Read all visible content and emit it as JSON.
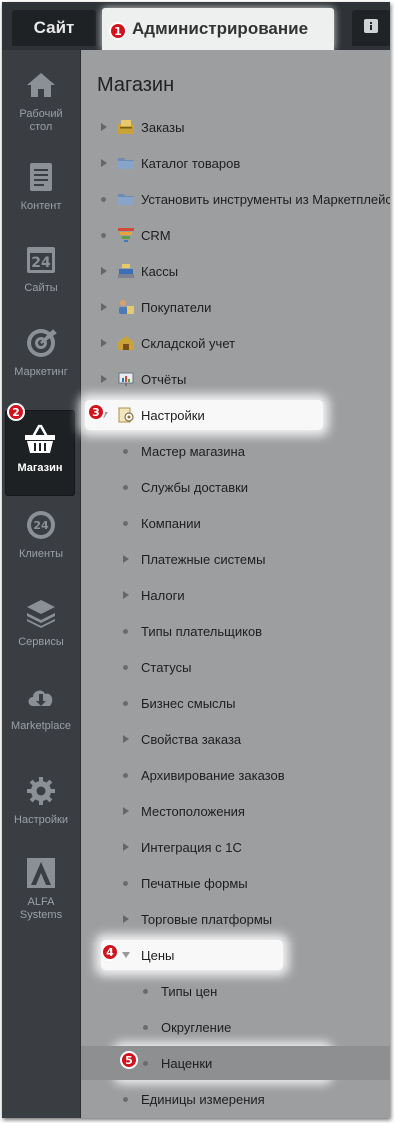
{
  "topbar": {
    "site_tab": "Сайт",
    "admin_tab": "Администрирование",
    "info_icon": "info-icon"
  },
  "sidebar": {
    "items": [
      {
        "key": "desktop",
        "label": "Рабочий стол",
        "icon": "home-icon"
      },
      {
        "key": "content",
        "label": "Контент",
        "icon": "document-icon"
      },
      {
        "key": "sites",
        "label": "Сайты",
        "icon": "calendar-24-icon"
      },
      {
        "key": "marketing",
        "label": "Маркетинг",
        "icon": "target-icon"
      },
      {
        "key": "store",
        "label": "Магазин",
        "icon": "basket-icon",
        "active": true
      },
      {
        "key": "clients",
        "label": "Клиенты",
        "icon": "clients-24-icon"
      },
      {
        "key": "services",
        "label": "Сервисы",
        "icon": "layers-icon"
      },
      {
        "key": "marketplace",
        "label": "Marketplace",
        "icon": "cloud-download-icon"
      },
      {
        "key": "settings",
        "label": "Настройки",
        "icon": "gear-icon"
      },
      {
        "key": "alfa",
        "label": "ALFA Systems",
        "icon": "alfa-logo-icon"
      }
    ]
  },
  "main": {
    "heading": "Магазин",
    "menu": [
      {
        "label": "Заказы",
        "marker": "arrow",
        "icon": "orders-icon"
      },
      {
        "label": "Каталог товаров",
        "marker": "arrow",
        "icon": "folder-icon"
      },
      {
        "label": "Установить инструменты из Маркетплейс",
        "marker": "dot",
        "icon": "folder-icon"
      },
      {
        "label": "CRM",
        "marker": "dot",
        "icon": "crm-funnel-icon"
      },
      {
        "label": "Кассы",
        "marker": "arrow",
        "icon": "cash-register-icon"
      },
      {
        "label": "Покупатели",
        "marker": "arrow",
        "icon": "buyers-icon"
      },
      {
        "label": "Складской учет",
        "marker": "arrow",
        "icon": "warehouse-icon"
      },
      {
        "label": "Отчёты",
        "marker": "arrow",
        "icon": "report-icon"
      },
      {
        "label": "Настройки",
        "marker": "open",
        "icon": "settings-doc-icon"
      },
      {
        "label": "Мастер магазина",
        "marker": "dot"
      },
      {
        "label": "Службы доставки",
        "marker": "dot"
      },
      {
        "label": "Компании",
        "marker": "dot"
      },
      {
        "label": "Платежные системы",
        "marker": "arrow"
      },
      {
        "label": "Налоги",
        "marker": "arrow"
      },
      {
        "label": "Типы плательщиков",
        "marker": "dot"
      },
      {
        "label": "Статусы",
        "marker": "dot"
      },
      {
        "label": "Бизнес смыслы",
        "marker": "dot"
      },
      {
        "label": "Свойства заказа",
        "marker": "arrow"
      },
      {
        "label": "Архивирование заказов",
        "marker": "dot"
      },
      {
        "label": "Местоположения",
        "marker": "arrow"
      },
      {
        "label": "Интеграция с 1С",
        "marker": "arrow"
      },
      {
        "label": "Печатные формы",
        "marker": "dot"
      },
      {
        "label": "Торговые платформы",
        "marker": "arrow"
      },
      {
        "label": "Цены",
        "marker": "open"
      },
      {
        "label": "Типы цен",
        "marker": "dot"
      },
      {
        "label": "Округление",
        "marker": "dot"
      },
      {
        "label": "Наценки",
        "marker": "dot",
        "selected": true
      },
      {
        "label": "Единицы измерения",
        "marker": "dot"
      }
    ]
  },
  "callouts": [
    "1",
    "2",
    "3",
    "4",
    "5"
  ],
  "colors": {
    "sidebar_bg": "#3a3e43",
    "content_bg": "#9c9ea0",
    "badge_red": "#d3131b",
    "active_item_bg": "#1e2124"
  }
}
